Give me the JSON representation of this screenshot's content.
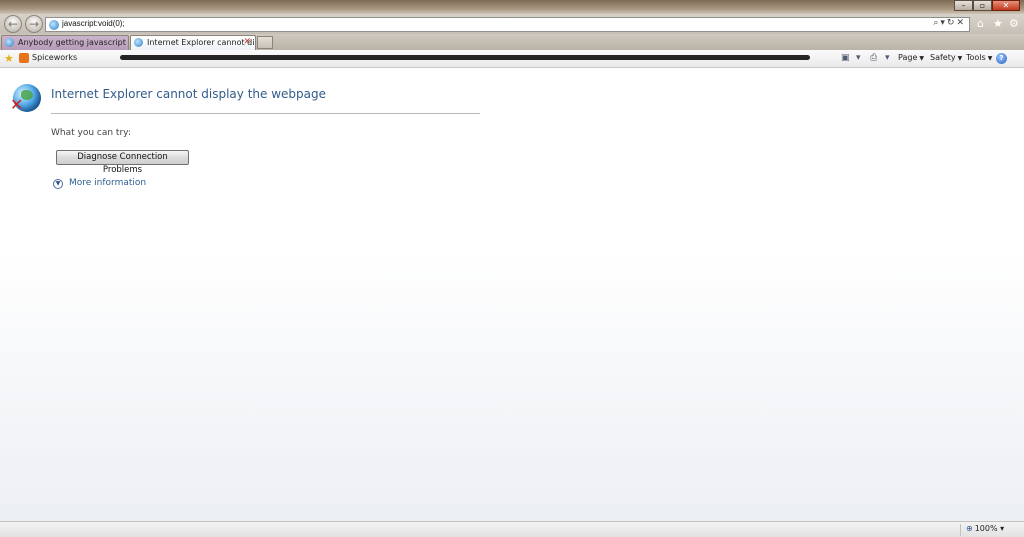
{
  "browser": {
    "address_url": "javascript:void(0);",
    "tabs": [
      {
        "label": "Anybody getting javascript err..."
      },
      {
        "label": "Internet Explorer cannot dis...",
        "close": "✕"
      }
    ],
    "favorites": {
      "first_label": "Spiceworks"
    },
    "command_bar": {
      "page_label": "Page",
      "safety_label": "Safety",
      "tools_label": "Tools"
    },
    "status": {
      "zoom_label": "100%"
    }
  },
  "content": {
    "error_title": "Internet Explorer cannot display the webpage",
    "try_label": "What you can try:",
    "diagnose_button": "Diagnose Connection Problems",
    "more_info_link": "More information"
  },
  "icons": {
    "back": "back-arrow-icon",
    "forward": "forward-arrow-icon",
    "home": "home-icon",
    "favorites": "star-icon",
    "tools": "gear-icon",
    "help": "help-icon",
    "error": "globe-error-icon"
  }
}
